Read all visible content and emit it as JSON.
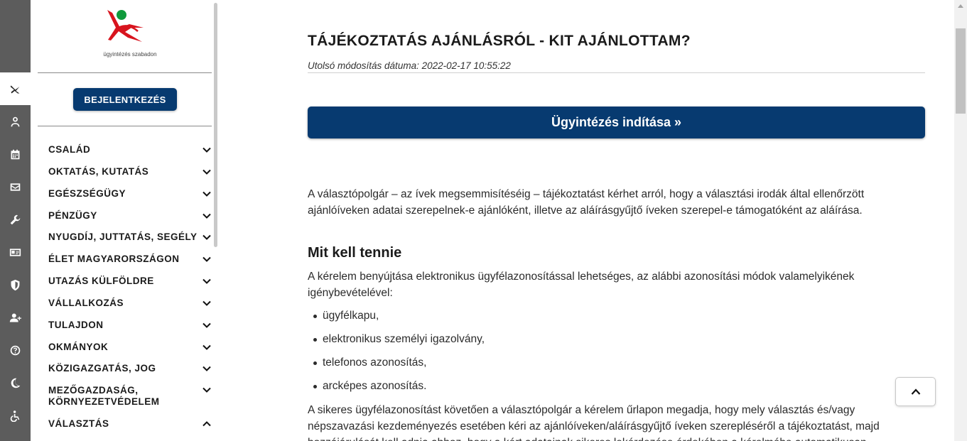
{
  "rail": {
    "icons": [
      {
        "name": "agency-logo-icon",
        "active": true
      },
      {
        "name": "user-icon"
      },
      {
        "name": "calendar-icon"
      },
      {
        "name": "mail-icon"
      },
      {
        "name": "wrench-icon"
      },
      {
        "name": "id-card-icon"
      },
      {
        "name": "shield-icon"
      },
      {
        "name": "add-user-icon"
      },
      {
        "name": "help-icon"
      },
      {
        "name": "moon-icon"
      },
      {
        "name": "accessibility-icon"
      }
    ]
  },
  "sidebar": {
    "logo_text": "ügyintézés szabadon",
    "login_label": "BEJELENTKEZÉS",
    "categories": [
      {
        "label": "CSALÁD",
        "expanded": false
      },
      {
        "label": "OKTATÁS, KUTATÁS",
        "expanded": false
      },
      {
        "label": "EGÉSZSÉGÜGY",
        "expanded": false
      },
      {
        "label": "PÉNZÜGY",
        "expanded": false
      },
      {
        "label": "NYUGDÍJ, JUTTATÁS, SEGÉLY",
        "expanded": false
      },
      {
        "label": "ÉLET MAGYARORSZÁGON",
        "expanded": false
      },
      {
        "label": "UTAZÁS KÜLFÖLDRE",
        "expanded": false
      },
      {
        "label": "VÁLLALKOZÁS",
        "expanded": false
      },
      {
        "label": "TULAJDON",
        "expanded": false
      },
      {
        "label": "OKMÁNYOK",
        "expanded": false
      },
      {
        "label": "KÖZIGAZGATÁS, JOG",
        "expanded": false
      },
      {
        "label": "MEZŐGAZDASÁG, KÖRNYEZETVÉDELEM",
        "line1": "MEZŐGAZDASÁG,",
        "line2": "KÖRNYEZETVÉDELEM",
        "expanded": false
      },
      {
        "label": "VÁLASZTÁS",
        "expanded": true
      }
    ]
  },
  "main": {
    "title": "TÁJÉKOZTATÁS AJÁNLÁSRÓL - KIT AJÁNLOTTAM?",
    "modified": "Utolsó módosítás dátuma: 2022-02-17 10:55:22",
    "start_button": "Ügyintézés indítása »",
    "intro_line1": "A választópolgár – az ívek megsemmisítéséig – tájékoztatást kérhet arról, hogy a választási irodák által ellenőrzött",
    "intro_line2": "ajánlóíveken adatai szerepelnek-e ajánlóként, illetve az aláírásgyűjtő íveken szerepel-e támogatóként az aláírása.",
    "section_heading": "Mit kell tennie",
    "req_line1": "A kérelem benyújtása elektronikus ügyfélazonosítással lehetséges, az alábbi azonosítási módok valamelyikének",
    "req_line2": "igénybevételével:",
    "methods": [
      "ügyfélkapu,",
      "elektronikus személyi igazolvány,",
      "telefonos azonosítás,",
      "arcképes azonosítás."
    ],
    "after_line1": "A sikeres ügyfélazonosítást követően a választópolgár a kérelem űrlapon megadja, hogy mely választás és/vagy",
    "after_line2": "népszavazási kezdeményezés esetében kéri az ajánlóíveken/aláírásgyűjtő íveken szerepléséről a tájékoztatást, majd",
    "after_line3": "hozzájárulását kell adnia ahhoz, hogy a kért adatainak sikeres lekérdezése érdekében a kérelmébe automatikusan"
  }
}
